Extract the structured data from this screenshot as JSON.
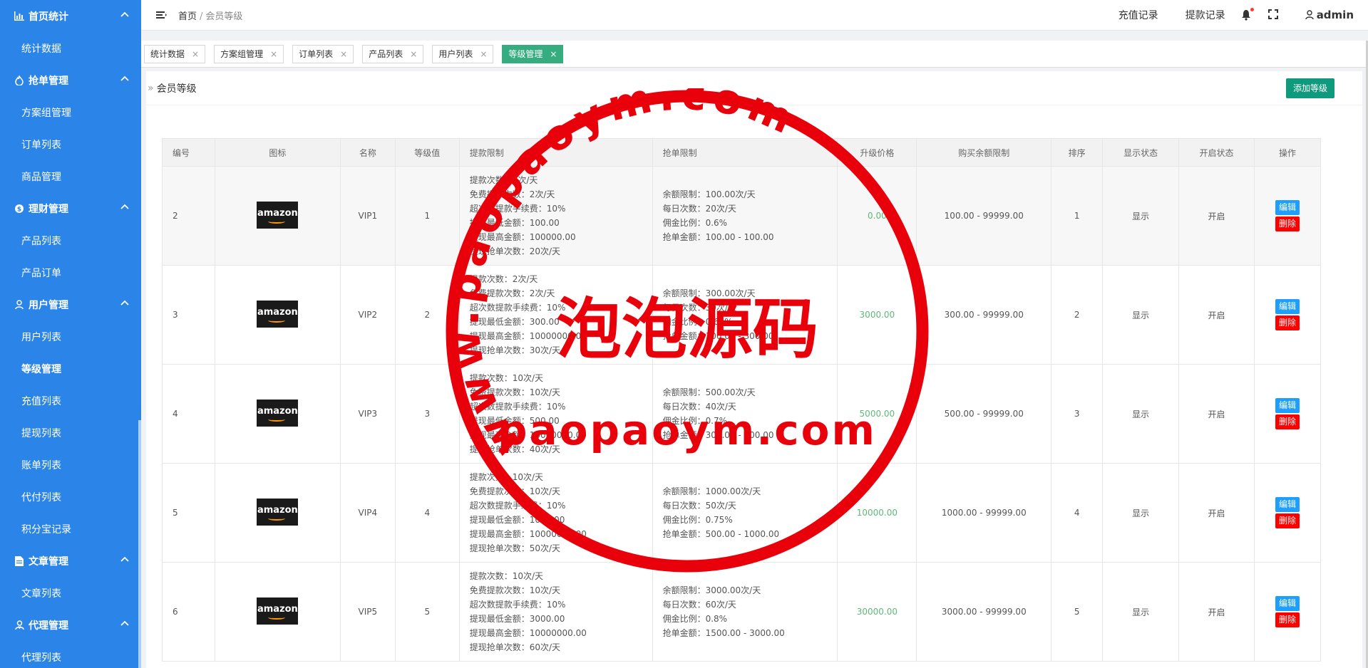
{
  "sidebar": {
    "groups": [
      {
        "label": "首页统计",
        "icon": "bar-chart-icon",
        "items": [
          "统计数据"
        ]
      },
      {
        "label": "抢单管理",
        "icon": "fire-icon",
        "items": [
          "方案组管理",
          "订单列表",
          "商品管理"
        ]
      },
      {
        "label": "理财管理",
        "icon": "dollar-icon",
        "items": [
          "产品列表",
          "产品订单"
        ]
      },
      {
        "label": "用户管理",
        "icon": "user-icon",
        "items": [
          "用户列表",
          "等级管理",
          "充值列表",
          "提现列表",
          "账单列表",
          "代付列表",
          "积分宝记录"
        ]
      },
      {
        "label": "文章管理",
        "icon": "document-icon",
        "items": [
          "文章列表"
        ]
      },
      {
        "label": "代理管理",
        "icon": "agent-icon",
        "items": [
          "代理列表"
        ]
      }
    ],
    "active_item": "等级管理"
  },
  "topbar": {
    "breadcrumb_home": "首页",
    "breadcrumb_sep": "/",
    "breadcrumb_current": "会员等级",
    "recharge_link": "充值记录",
    "withdraw_link": "提款记录",
    "username": "admin"
  },
  "tabs": [
    {
      "label": "统计数据",
      "active": false
    },
    {
      "label": "方案组管理",
      "active": false
    },
    {
      "label": "订单列表",
      "active": false
    },
    {
      "label": "产品列表",
      "active": false
    },
    {
      "label": "用户列表",
      "active": false
    },
    {
      "label": "等级管理",
      "active": true
    }
  ],
  "tab_close": "×",
  "panel": {
    "title": "会员等级",
    "add_button": "添加等级"
  },
  "table": {
    "headers": [
      "编号",
      "图标",
      "名称",
      "等级值",
      "提款限制",
      "抢单限制",
      "升级价格",
      "购买余额限制",
      "排序",
      "显示状态",
      "开启状态",
      "操作"
    ],
    "edit_label": "编辑",
    "delete_label": "删除",
    "logo_text": "amazon",
    "rows": [
      {
        "id": "2",
        "name": "VIP1",
        "level": "1",
        "withdraw": [
          "提款次数：2次/天",
          "免费提款次数：2次/天",
          "超次数提款手续费：10%",
          "提现最低金额：100.00",
          "提现最高金额：100000.00",
          "提现抢单次数：20次/天"
        ],
        "grab": [
          "余额限制：100.00次/天",
          "每日次数：20次/天",
          "佣金比例：0.6%",
          "抢单金额：100.00 - 100.00"
        ],
        "price": "0.00",
        "balance": "100.00 - 99999.00",
        "sort": "1",
        "show": "显示",
        "open": "开启"
      },
      {
        "id": "3",
        "name": "VIP2",
        "level": "2",
        "withdraw": [
          "提款次数：2次/天",
          "免费提款次数：2次/天",
          "超次数提款手续费：10%",
          "提现最低金额：300.00",
          "提现最高金额：10000000.00",
          "提现抢单次数：30次/天"
        ],
        "grab": [
          "余额限制：300.00次/天",
          "每日次数：30次/天",
          "佣金比例：0.65%",
          "抢单金额：100.00 - 300.00"
        ],
        "price": "3000.00",
        "balance": "300.00 - 99999.00",
        "sort": "2",
        "show": "显示",
        "open": "开启"
      },
      {
        "id": "4",
        "name": "VIP3",
        "level": "3",
        "withdraw": [
          "提款次数：10次/天",
          "免费提款次数：10次/天",
          "超次数提款手续费：10%",
          "提现最低金额：500.00",
          "提现最高金额：10000000.00",
          "提现抢单次数：40次/天"
        ],
        "grab": [
          "余额限制：500.00次/天",
          "每日次数：40次/天",
          "佣金比例：0.7%",
          "抢单金额：300.00 - 500.00"
        ],
        "price": "5000.00",
        "balance": "500.00 - 99999.00",
        "sort": "3",
        "show": "显示",
        "open": "开启"
      },
      {
        "id": "5",
        "name": "VIP4",
        "level": "4",
        "withdraw": [
          "提款次数：10次/天",
          "免费提款次数：10次/天",
          "超次数提款手续费：10%",
          "提现最低金额：1000.00",
          "提现最高金额：10000000.00",
          "提现抢单次数：50次/天"
        ],
        "grab": [
          "余额限制：1000.00次/天",
          "每日次数：50次/天",
          "佣金比例：0.75%",
          "抢单金额：500.00 - 1000.00"
        ],
        "price": "10000.00",
        "balance": "1000.00 - 99999.00",
        "sort": "4",
        "show": "显示",
        "open": "开启"
      },
      {
        "id": "6",
        "name": "VIP5",
        "level": "5",
        "withdraw": [
          "提款次数：10次/天",
          "免费提款次数：10次/天",
          "超次数提款手续费：10%",
          "提现最低金额：3000.00",
          "提现最高金额：10000000.00",
          "提现抢单次数：60次/天"
        ],
        "grab": [
          "余额限制：3000.00次/天",
          "每日次数：60次/天",
          "佣金比例：0.8%",
          "抢单金额：1500.00 - 3000.00"
        ],
        "price": "30000.00",
        "balance": "3000.00 - 99999.00",
        "sort": "5",
        "show": "显示",
        "open": "开启"
      }
    ]
  },
  "watermark": {
    "ring_text": "www.paopaoym.com",
    "center_text": "泡泡源码",
    "bottom_text": "paopaoym.com",
    "color": "#e8000b"
  },
  "colors": {
    "sidebar_bg": "#2b84e8",
    "active_tab": "#35ad7e",
    "add_button": "#0f9a7d",
    "edit_button": "#1e9fff",
    "delete_button": "#ff0000",
    "price_green": "#5fb878"
  }
}
